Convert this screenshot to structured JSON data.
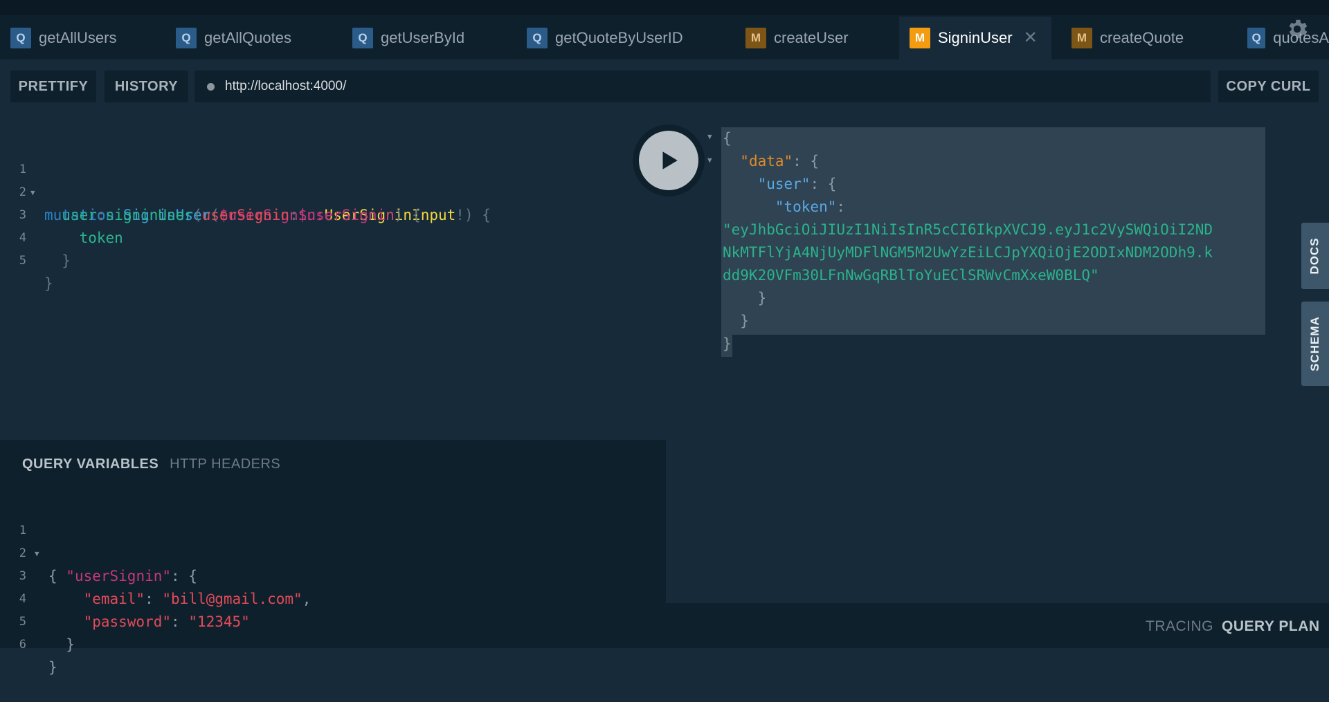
{
  "tabs": [
    {
      "type": "Q",
      "label": "getAllUsers"
    },
    {
      "type": "Q",
      "label": "getAllQuotes"
    },
    {
      "type": "Q",
      "label": "getUserById"
    },
    {
      "type": "Q",
      "label": "getQuoteByUserID"
    },
    {
      "type": "M",
      "label": "createUser"
    },
    {
      "type": "M",
      "label": "SigninUser",
      "active": true,
      "close": "✕"
    },
    {
      "type": "M",
      "label": "createQuote"
    },
    {
      "type": "Q",
      "label": "quotesA"
    }
  ],
  "toolbar": {
    "prettify": "PRETTIFY",
    "history": "HISTORY",
    "url": "http://localhost:4000/",
    "copy_curl": "COPY CURL"
  },
  "editor": {
    "line_numbers": [
      "1",
      "2",
      "3",
      "4",
      "5"
    ],
    "lines": {
      "l1": {
        "kw": "mutation",
        "op": "SigninUser",
        "p1": "(",
        "var": "$userSignin",
        "colon": ":",
        "type": "UserSigninInput",
        "bang": "!",
        "p2": ")",
        "brace": "{"
      },
      "l2": {
        "alias": "user",
        "colon": ":",
        "field": "signinUser",
        "p1": "(",
        "arg": "userSignin",
        "colon2": ":",
        "var": "$userSignin",
        "p2": ")",
        "brace": "{"
      },
      "l3": {
        "field": "token"
      },
      "l4": {
        "brace": "}"
      },
      "l5": {
        "brace": "}"
      }
    }
  },
  "variables": {
    "tab_query_variables": "QUERY VARIABLES",
    "tab_http_headers": "HTTP HEADERS",
    "line_numbers": [
      "1",
      "2",
      "3",
      "4",
      "5",
      "6"
    ],
    "lines": {
      "l1": {
        "brace": "{"
      },
      "l2": {
        "key": "\"userSignin\"",
        "colon": ": ",
        "brace": "{"
      },
      "l3": {
        "key": "\"email\"",
        "colon": ": ",
        "value": "\"bill@gmail.com\"",
        "comma": ","
      },
      "l4": {
        "key": "\"password\"",
        "colon": ": ",
        "value": "\"12345\""
      },
      "l5": {
        "brace": "}"
      },
      "l6": {
        "brace": "}"
      }
    }
  },
  "result": {
    "l1": "{",
    "l2": {
      "key": "\"data\"",
      "colon": ": ",
      "brace": "{"
    },
    "l3": {
      "key": "\"user\"",
      "colon": ": ",
      "brace": "{"
    },
    "l4": {
      "key": "\"token\"",
      "colon": ":"
    },
    "token_lines": [
      "\"eyJhbGciOiJIUzI1NiIsInR5cCI6IkpXVCJ9.eyJ1c2VySWQiOiI2ND",
      "NkMTFlYjA4NjUyMDFlNGM5M2UwYzEiLCJpYXQiOjE2ODIxNDM2ODh9.k",
      "dd9K20VFm30LFnNwGqRBlToYuEClSRWvCmXxeW0BLQ\""
    ],
    "l8": "}",
    "l9": "}",
    "l10": "}"
  },
  "side_tabs": {
    "docs": "DOCS",
    "schema": "SCHEMA"
  },
  "footer": {
    "tracing": "TRACING",
    "query_plan": "QUERY PLAN"
  },
  "colors": {
    "accent_mutation": "#f39c12",
    "query_badge": "#2b5b88",
    "background": "#172a3a",
    "panel": "#0f202d"
  },
  "icons": {
    "settings": "gear-icon",
    "run": "play-icon",
    "close": "close-icon"
  }
}
